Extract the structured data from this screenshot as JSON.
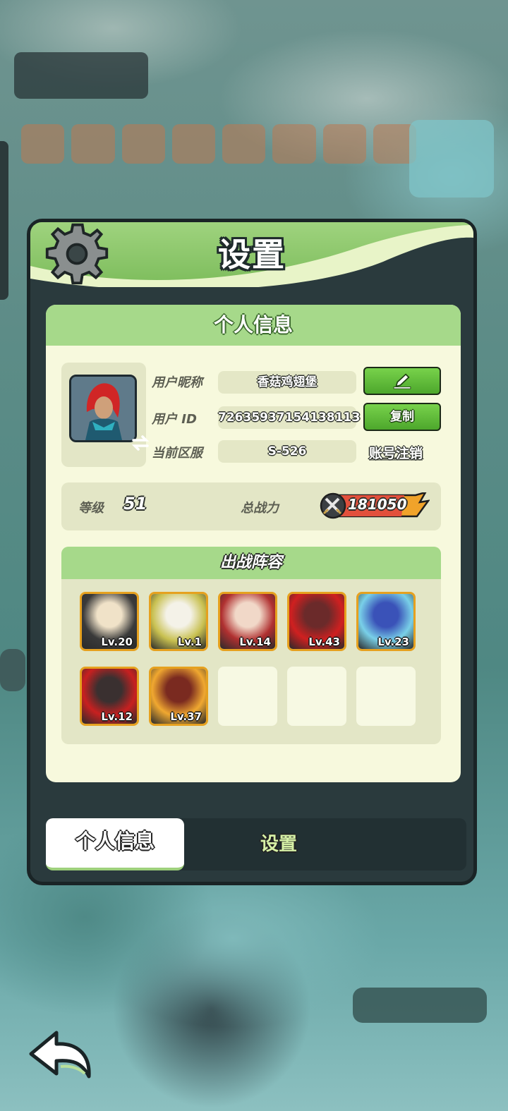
{
  "panel": {
    "title": "设置",
    "section_title": "个人信息"
  },
  "profile": {
    "nickname_label": "用户昵称",
    "nickname": "香菇鸡翅堡",
    "id_label": "用户 ID",
    "user_id": "7263593715413811З",
    "server_label": "当前区服",
    "server": "S-526",
    "copy_label": "复制",
    "logout_label": "账号注销"
  },
  "stats": {
    "level_label": "等级",
    "level": "51",
    "power_label": "总战力",
    "power": "181050"
  },
  "lineup": {
    "title": "出战阵容",
    "heroes": [
      {
        "level": "Lv.20",
        "colors": [
          "#f0e2c8",
          "#3a3a3a"
        ]
      },
      {
        "level": "Lv.1",
        "colors": [
          "#f4f2e8",
          "#c8c050"
        ]
      },
      {
        "level": "Lv.14",
        "colors": [
          "#f1d8c8",
          "#b03030"
        ]
      },
      {
        "level": "Lv.43",
        "colors": [
          "#6b2a2a",
          "#d02020"
        ]
      },
      {
        "level": "Lv.23",
        "colors": [
          "#3a52b8",
          "#79d0e8"
        ]
      },
      {
        "level": "Lv.12",
        "colors": [
          "#3a3030",
          "#c82020"
        ]
      },
      {
        "level": "Lv.37",
        "colors": [
          "#7a2a20",
          "#f0a830"
        ]
      }
    ],
    "empty_slots": 3
  },
  "tabs": {
    "active": "个人信息",
    "inactive": "设置"
  },
  "colors": {
    "header_green": "#9fd37e",
    "card_bg": "#f7f9dd",
    "button_green": "#5fbd38",
    "hero_border": "#e6a11f"
  },
  "icons": [
    "gear-icon",
    "pencil-icon",
    "swap-icon",
    "swords-icon",
    "back-arrow-icon"
  ]
}
